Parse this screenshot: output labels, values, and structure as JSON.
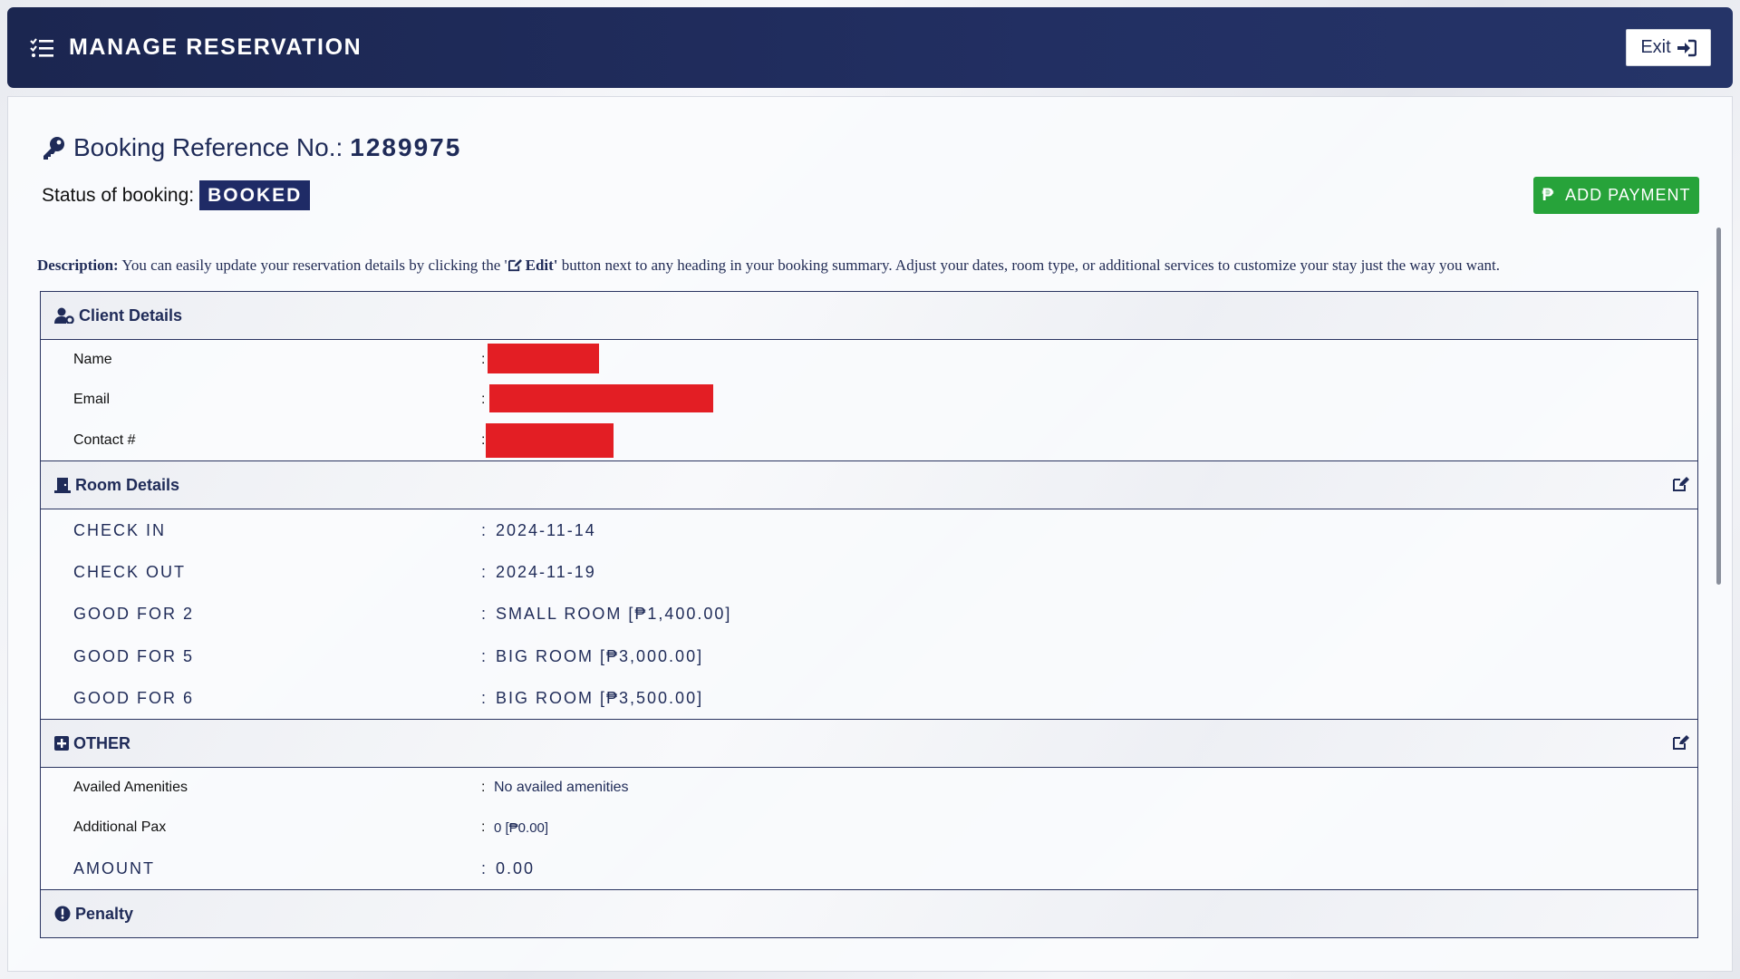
{
  "header": {
    "title": "MANAGE RESERVATION",
    "exit_label": "Exit"
  },
  "booking": {
    "reference_label": "Booking Reference No.:",
    "reference_no": "1289975",
    "status_label": "Status of booking:",
    "status_value": "BOOKED",
    "add_payment_label": "ADD PAYMENT",
    "add_payment_symbol": "₱"
  },
  "description": {
    "label": "Description:",
    "text_before": " You can easily update your reservation details by clicking the '",
    "edit_word": "Edit'",
    "text_after": " button next to any heading in your booking summary. Adjust your dates, room type, or additional services to customize your stay just the way you want."
  },
  "sections": {
    "client": {
      "title": "Client Details",
      "rows": [
        {
          "label": "Name",
          "value": ""
        },
        {
          "label": "Email",
          "value": ""
        },
        {
          "label": "Contact #",
          "value": ""
        }
      ]
    },
    "room": {
      "title": "Room Details",
      "rows": [
        {
          "label": "CHECK IN",
          "value": "2024-11-14"
        },
        {
          "label": "CHECK OUT",
          "value": "2024-11-19"
        },
        {
          "label": "GOOD FOR 2",
          "value": "SMALL ROOM [₱1,400.00]"
        },
        {
          "label": "GOOD FOR 5",
          "value": "BIG ROOM [₱3,000.00]"
        },
        {
          "label": "GOOD FOR 6",
          "value": "BIG ROOM [₱3,500.00]"
        }
      ]
    },
    "other": {
      "title": "OTHER",
      "rows": [
        {
          "label": "Availed Amenities",
          "value": "No availed amenities"
        },
        {
          "label": "Additional Pax",
          "value": "0 [₱0.00]"
        },
        {
          "label": "AMOUNT",
          "value": "0.00"
        }
      ]
    },
    "penalty": {
      "title": "Penalty"
    }
  },
  "colors": {
    "header_bg": "#1b2650",
    "accent_navy": "#1f2b66",
    "add_payment_green": "#27a33a",
    "redaction_red": "#e31e24"
  },
  "icons": {
    "header": "list-check-icon",
    "exit": "sign-in-icon",
    "reference": "key-icon",
    "client": "user-gear-icon",
    "room": "door-icon",
    "other": "plus-square-icon",
    "penalty": "exclamation-circle-icon",
    "edit": "edit-icon"
  }
}
